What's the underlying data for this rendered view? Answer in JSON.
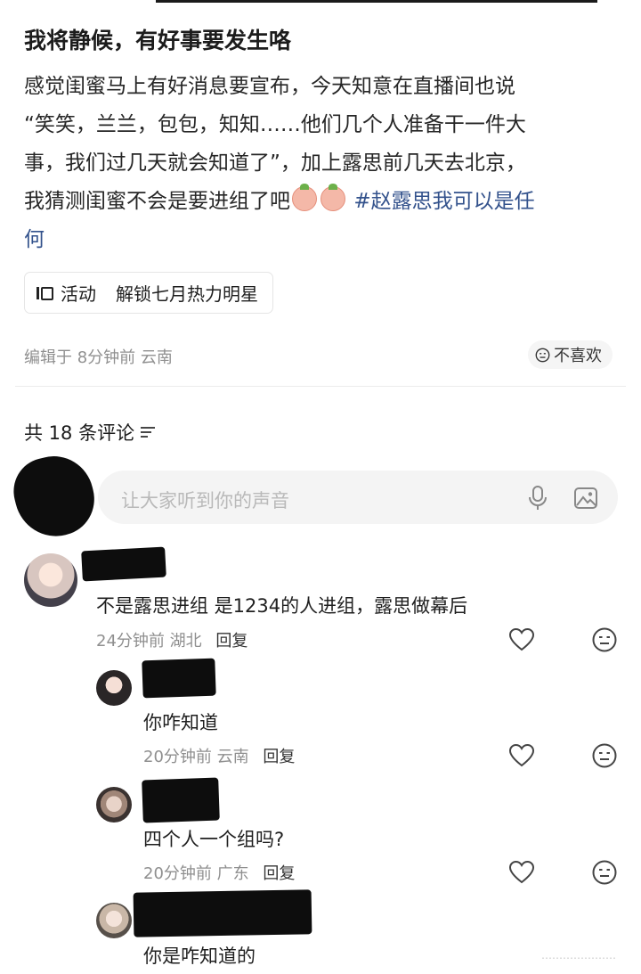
{
  "post": {
    "title": "我将静候，有好事要发生咯",
    "body_lines": [
      "感觉闺蜜马上有好消息要宣布，今天知意在直播间也说",
      "“笑笑，兰兰，包包，知知……他们几个人准备干一件大",
      "事，我们过几天就会知道了”，加上露思前几天去北京，",
      "我猜测闺蜜不会是要进组了吧"
    ],
    "hashtag_part1": "#赵露思我可以是任",
    "hashtag_part2": "何",
    "activity_label": "活动",
    "activity_text": "解锁七月热力明星",
    "meta": "编辑于 8分钟前 云南",
    "dislike_label": "不喜欢",
    "emoji_icons": [
      "peach-emoji-icon",
      "peach-emoji-icon"
    ]
  },
  "comments_section": {
    "count_label": "共 18 条评论",
    "input_placeholder": "让大家听到你的声音",
    "input_icons": [
      "microphone-icon",
      "image-icon"
    ]
  },
  "comments": [
    {
      "text": "不是露思进组 是1234的人进组，露思做幕后",
      "time": "24分钟前",
      "location": "湖北",
      "reply_label": "回复"
    },
    {
      "text": "你咋知道",
      "time": "20分钟前",
      "location": "云南",
      "reply_label": "回复"
    },
    {
      "text": "四个人一个组吗?",
      "time": "20分钟前",
      "location": "广东",
      "reply_label": "回复"
    },
    {
      "text": "你是咋知道的"
    }
  ],
  "colors": {
    "hashtag": "#33528c",
    "meta": "#8f8f8f",
    "input_bg": "#f4f4f4",
    "redaction": "#0d0d0d"
  }
}
